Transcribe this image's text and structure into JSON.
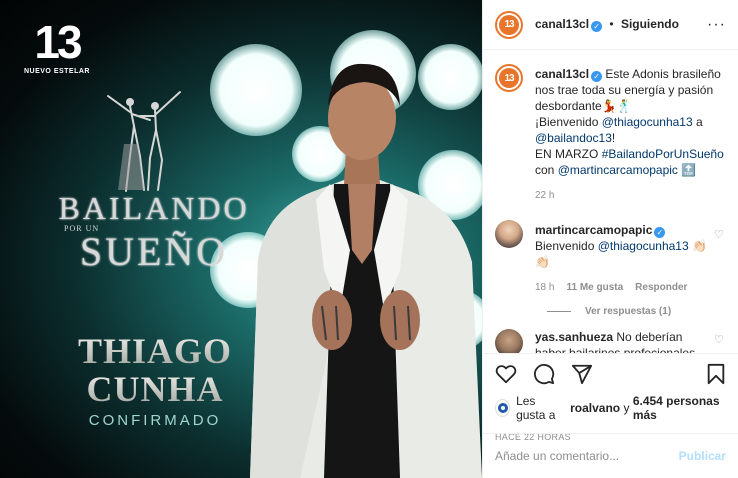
{
  "media": {
    "logo_number": "13",
    "logo_subtitle": "NUEVO ESTELAR",
    "show_word1": "BAILANDO",
    "show_word2": "POR UN",
    "show_word3": "SUEÑO",
    "name_line1": "THIAGO",
    "name_line2": "CUNHA",
    "status": "CONFIRMADO"
  },
  "header": {
    "avatar_text": "13",
    "username": "canal13cl",
    "separator": "•",
    "follow_label": "Siguiendo",
    "more_label": "···"
  },
  "caption": {
    "username": "canal13cl",
    "text_part1": "Este Adonis brasileño nos trae toda su energía y pasión desbordante💃🕺",
    "text_part2": "¡Bienvenido",
    "mention1": "@thiagocunha13",
    "text_part3": "a",
    "mention2": "@bailandoc13",
    "text_part4": "!",
    "text_part5": "EN MARZO",
    "hashtag": "#BailandoPorUnSueño",
    "text_part6": "con",
    "mention3": "@martincarcamopapic",
    "emoji_end": "🔝",
    "time": "22 h"
  },
  "comments": [
    {
      "username": "martincarcamopapic",
      "text_prefix": "Bienvenido",
      "mention": "@thiagocunha13",
      "text_suffix": "👏🏻👏🏻",
      "time": "18 h",
      "likes": "11 Me gusta",
      "reply_label": "Responder",
      "view_replies": "Ver respuestas (1)"
    },
    {
      "username": "yas.sanhueza",
      "text": "No deberían haber bailarines profecionales"
    }
  ],
  "likes": {
    "prefix": "Les gusta a",
    "user": "roalvano",
    "middle": "y",
    "count": "6.454 personas más"
  },
  "posted_ago": "HACE 22 HORAS",
  "add_comment": {
    "placeholder": "Añade un comentario...",
    "publish_label": "Publicar"
  },
  "colors": {
    "brand_orange": "#e8752a",
    "verified_blue": "#3897f0",
    "link": "#00376b",
    "publish_disabled": "#b2dffc"
  }
}
